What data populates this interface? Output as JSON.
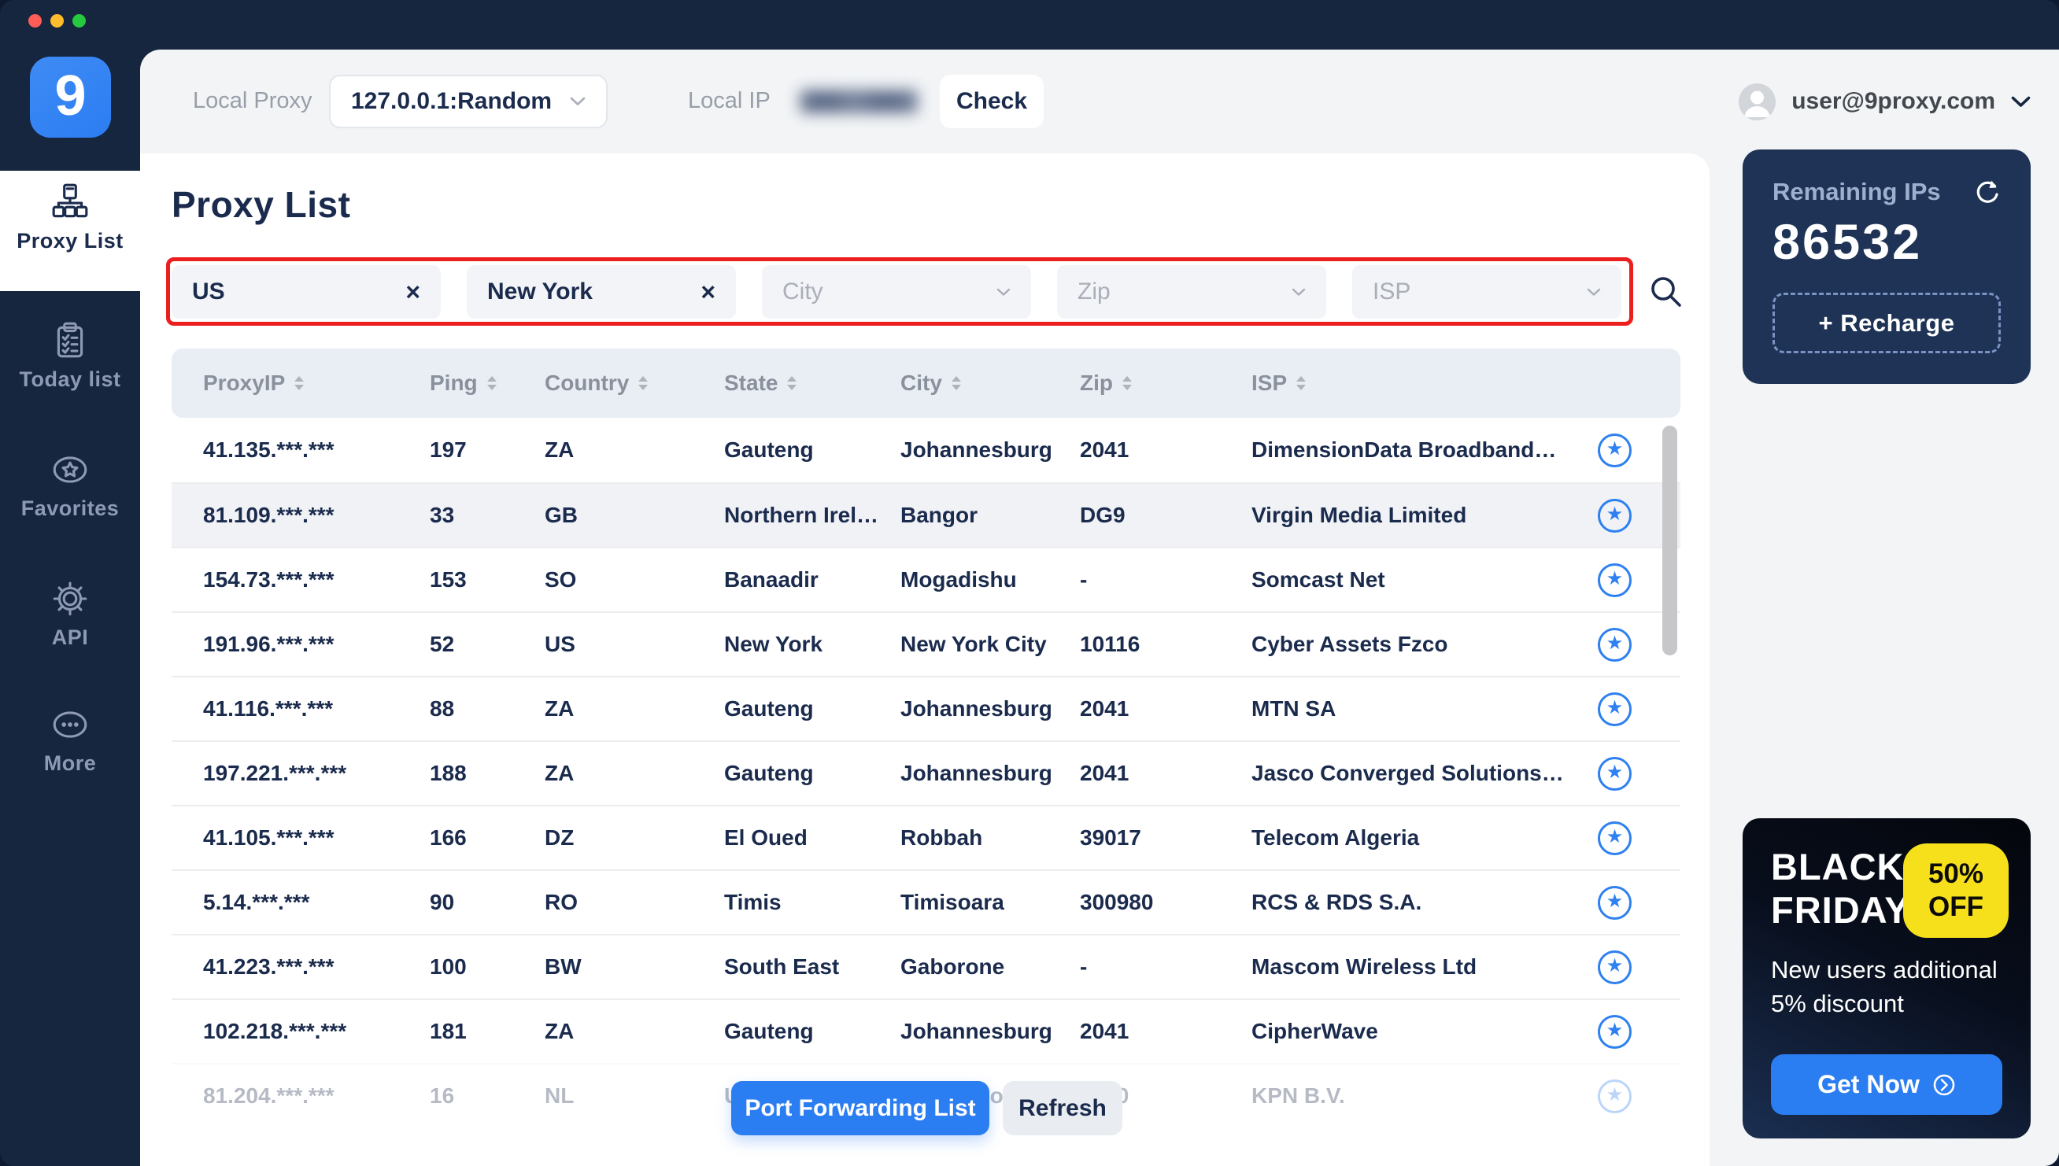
{
  "window": {
    "traffic_lights": [
      {
        "name": "close",
        "color": "#ff5d55"
      },
      {
        "name": "minimize",
        "color": "#ffbd2e"
      },
      {
        "name": "zoom",
        "color": "#27c93f"
      }
    ]
  },
  "topbar": {
    "local_proxy_label": "Local Proxy",
    "local_proxy_value": "127.0.0.1:Random",
    "local_ip_label": "Local IP",
    "local_ip_value": "(blurred)",
    "check_label": "Check",
    "user_email": "user@9proxy.com"
  },
  "sidebar": {
    "logo_text": "9",
    "items": [
      {
        "label": "Proxy List",
        "icon": "sitemap-icon",
        "active": true
      },
      {
        "label": "Today list",
        "icon": "checklist-icon",
        "active": false
      },
      {
        "label": "Favorites",
        "icon": "star-circle-icon",
        "active": false
      },
      {
        "label": "API",
        "icon": "gear-icon",
        "active": false
      },
      {
        "label": "More",
        "icon": "ellipsis-icon",
        "active": false
      }
    ]
  },
  "main": {
    "title": "Proxy List",
    "filters": [
      {
        "kind": "chip",
        "value": "US"
      },
      {
        "kind": "chip",
        "value": "New York"
      },
      {
        "kind": "select",
        "placeholder": "City"
      },
      {
        "kind": "select",
        "placeholder": "Zip"
      },
      {
        "kind": "select",
        "placeholder": "ISP"
      }
    ],
    "table": {
      "columns": [
        "ProxyIP",
        "Ping",
        "Country",
        "State",
        "City",
        "Zip",
        "ISP"
      ],
      "highlighted_row_index": 1,
      "faded_row_index": 10,
      "rows": [
        [
          "41.135.***.***",
          "197",
          "ZA",
          "Gauteng",
          "Johannesburg",
          "2041",
          "DimensionData Broadband…"
        ],
        [
          "81.109.***.***",
          "33",
          "GB",
          "Northern Irel…",
          "Bangor",
          "DG9",
          "Virgin Media Limited"
        ],
        [
          "154.73.***.***",
          "153",
          "SO",
          "Banaadir",
          "Mogadishu",
          "-",
          "Somcast Net"
        ],
        [
          "191.96.***.***",
          "52",
          "US",
          "New York",
          "New York City",
          "10116",
          "Cyber Assets Fzco"
        ],
        [
          "41.116.***.***",
          "88",
          "ZA",
          "Gauteng",
          "Johannesburg",
          "2041",
          "MTN SA"
        ],
        [
          "197.221.***.***",
          "188",
          "ZA",
          "Gauteng",
          "Johannesburg",
          "2041",
          "Jasco Converged Solutions…"
        ],
        [
          "41.105.***.***",
          "166",
          "DZ",
          "El Oued",
          "Robbah",
          "39017",
          "Telecom Algeria"
        ],
        [
          "5.14.***.***",
          "90",
          "RO",
          "Timis",
          "Timisoara",
          "300980",
          "RCS & RDS S.A."
        ],
        [
          "41.223.***.***",
          "100",
          "BW",
          "South East",
          "Gaborone",
          "-",
          "Mascom Wireless Ltd"
        ],
        [
          "102.218.***.***",
          "181",
          "ZA",
          "Gauteng",
          "Johannesburg",
          "2041",
          "CipherWave"
        ],
        [
          "81.204.***.***",
          "16",
          "NL",
          "Utrecht",
          "Amersfoort",
          "3820",
          "KPN B.V."
        ]
      ]
    },
    "actions": {
      "port_forwarding_label": "Port Forwarding List",
      "refresh_label": "Refresh"
    }
  },
  "right_panel": {
    "remaining": {
      "label": "Remaining IPs",
      "value": "86532",
      "recharge_label": "+ Recharge"
    },
    "promo": {
      "title_line1": "BLACK",
      "title_line2": "FRIDAY",
      "badge_line1": "50%",
      "badge_line2": "OFF",
      "description": "New users additional 5% discount",
      "cta_label": "Get Now"
    }
  },
  "colors": {
    "sidebar_navy": "#16263e",
    "card_navy": "#1e3356",
    "accent_blue": "#2b7df2",
    "filter_highlight_red": "#ec1f1f",
    "promo_yellow": "#f6e01c",
    "star_blue": "#2f80f0"
  }
}
